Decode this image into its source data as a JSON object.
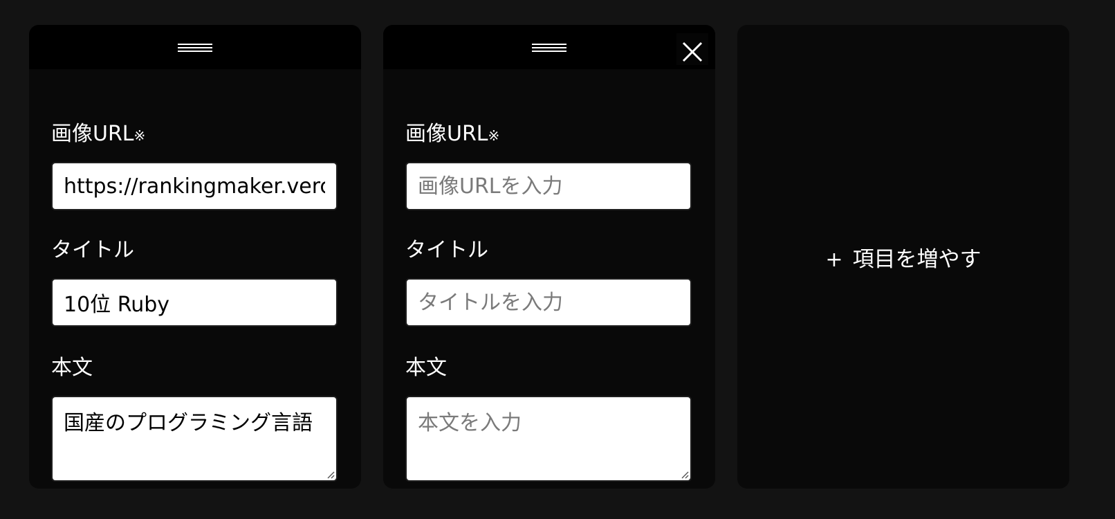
{
  "labels": {
    "image_url": "画像URL",
    "required_mark": "※",
    "title": "タイトル",
    "body": "本文"
  },
  "items": [
    {
      "image_url_value": "https://rankingmaker.vercel.app",
      "title_value": "10位 Ruby",
      "body_value": "国産のプログラミング言語"
    },
    {
      "image_url_placeholder": "画像URLを入力",
      "title_placeholder": "タイトルを入力",
      "body_placeholder": "本文を入力"
    }
  ],
  "add_item": {
    "plus": "+",
    "label": "項目を増やす"
  },
  "icons": {
    "drag": "drag-handle-icon",
    "close": "close-icon",
    "resize": "resize-grip-icon",
    "plus": "plus-icon"
  },
  "colors": {
    "page_bg": "#131313",
    "card_bg": "#090909",
    "header_bg": "#000000",
    "text": "#ffffff",
    "placeholder": "#7a7a7a"
  }
}
